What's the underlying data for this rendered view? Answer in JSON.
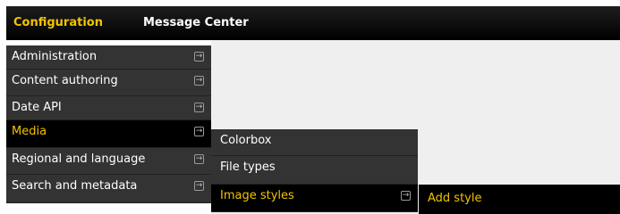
{
  "top_tabs": [
    {
      "label": "Configuration",
      "active": true
    },
    {
      "label": "Message Center",
      "active": false
    }
  ],
  "menu_level1": [
    {
      "label": "Administration"
    },
    {
      "label": "Content authoring"
    },
    {
      "label": "Date API"
    },
    {
      "label": "Media",
      "active": true
    },
    {
      "label": "Regional and language"
    },
    {
      "label": "Search and metadata"
    }
  ],
  "menu_level2": [
    {
      "label": "Colorbox"
    },
    {
      "label": "File types"
    },
    {
      "label": "Image styles",
      "active": true
    }
  ],
  "menu_level3": [
    {
      "label": "Add style",
      "active": true
    }
  ],
  "icons": {
    "submenu": "submenu-arrow-icon"
  },
  "colors": {
    "accent": "#f2c400",
    "menu_bg": "#333333",
    "active_bg": "#000000"
  }
}
